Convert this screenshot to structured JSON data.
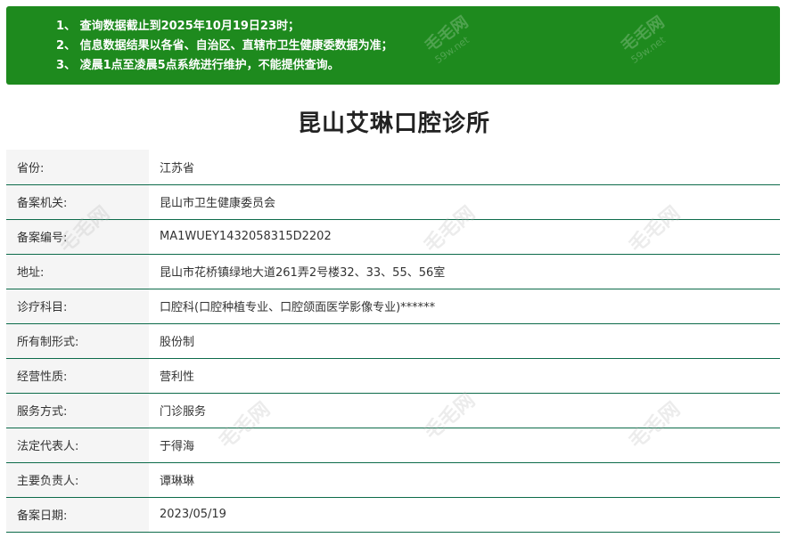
{
  "notice": {
    "lines": [
      "1、 查询数据截止到2025年10月19日23时；",
      "2、 信息数据结果以各省、自治区、直辖市卫生健康委数据为准；",
      "3、 凌晨1点至凌晨5点系统进行维护，不能提供查询。"
    ],
    "watermark": "毛毛网",
    "watermark_sub": "59w.net",
    "background": "#1e8a1e"
  },
  "title": "昆山艾琳口腔诊所",
  "rows": [
    {
      "label": "省份:",
      "value": "江苏省"
    },
    {
      "label": "备案机关:",
      "value": "昆山市卫生健康委员会"
    },
    {
      "label": "备案编号:",
      "value": "MA1WUEY1432058315D2202"
    },
    {
      "label": "地址:",
      "value": "昆山市花桥镇绿地大道261弄2号楼32、33、55、56室"
    },
    {
      "label": "诊疗科目:",
      "value": "口腔科(口腔种植专业、口腔颌面医学影像专业)******"
    },
    {
      "label": "所有制形式:",
      "value": "股份制"
    },
    {
      "label": "经营性质:",
      "value": "营利性"
    },
    {
      "label": "服务方式:",
      "value": "门诊服务"
    },
    {
      "label": "法定代表人:",
      "value": "于得海"
    },
    {
      "label": "主要负责人:",
      "value": "谭琳琳"
    },
    {
      "label": "备案日期:",
      "value": "2023/05/19"
    }
  ]
}
